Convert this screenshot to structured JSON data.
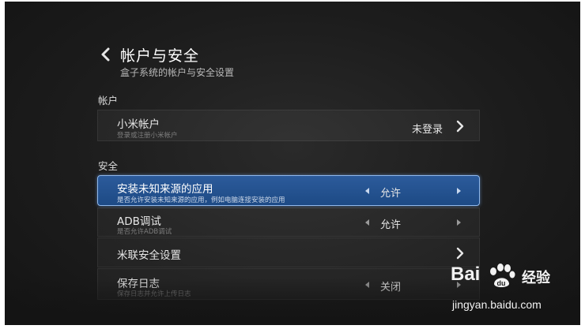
{
  "header": {
    "title": "帐户与安全",
    "subtitle": "盒子系统的帐户与安全设置"
  },
  "sections": {
    "account": "帐户",
    "security": "安全"
  },
  "rows": {
    "mi_account": {
      "label": "小米帐户",
      "desc": "登录或注册小米帐户",
      "value": "未登录"
    },
    "unknown_sources": {
      "label": "安装未知来源的应用",
      "desc": "是否允许安装未知来源的应用，例如电脑连接安装的应用",
      "value": "允许"
    },
    "adb": {
      "label": "ADB调试",
      "desc": "是否允许ADB调试",
      "value": "允许"
    },
    "milian_security": {
      "label": "米联安全设置"
    },
    "save_log": {
      "label": "保存日志",
      "desc": "保存日志并允许上传日志",
      "value": "关闭"
    }
  },
  "watermark": {
    "brand": "Bai",
    "brand_suffix": "经验",
    "url": "jingyan.baidu.com"
  },
  "colors": {
    "background": "#1c1c1c",
    "selected_row": "#2c5b9b",
    "selected_border": "#8fb8ec"
  }
}
